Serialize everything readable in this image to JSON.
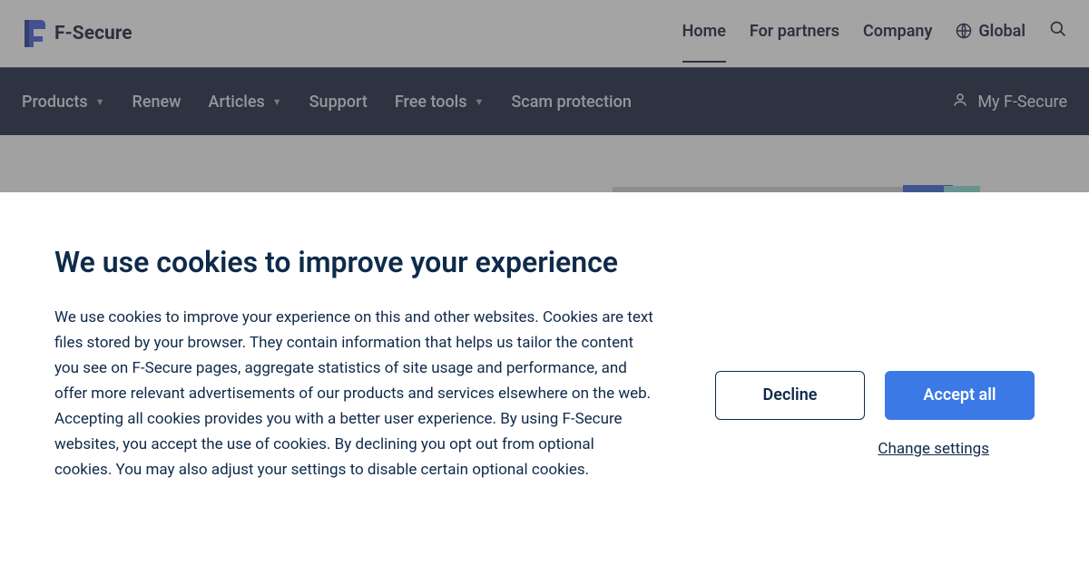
{
  "brand": {
    "name": "F-Secure",
    "accent": "#3752d0"
  },
  "top_nav": {
    "home": "Home",
    "partners": "For partners",
    "company": "Company",
    "global": "Global"
  },
  "sub_nav": {
    "products": "Products",
    "renew": "Renew",
    "articles": "Articles",
    "support": "Support",
    "free_tools": "Free tools",
    "scam_protection": "Scam protection",
    "my_account": "My F-Secure"
  },
  "cookies": {
    "title": "We use cookies to improve your experience",
    "body": "We use cookies to improve your experience on this and other websites. Cookies are text files stored by your browser. They contain information that helps us tailor the content you see on F-Secure pages, aggregate statistics of site usage and performance, and offer more relevant advertisements of our products and services elsewhere on the web. Accepting all cookies provides you with a better user experience. By using F-Secure websites, you accept the use of cookies. By declining you opt out from optional cookies. You may also adjust your settings to disable certain optional cookies.",
    "decline": "Decline",
    "accept": "Accept all",
    "change": "Change settings"
  }
}
